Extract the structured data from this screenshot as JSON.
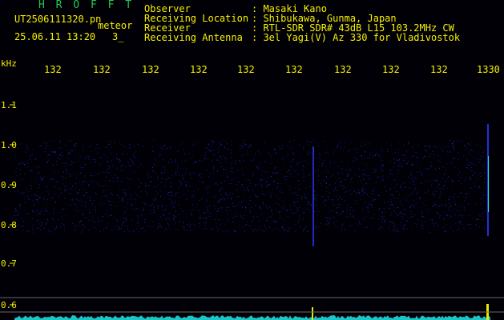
{
  "header": {
    "station": "H R O F F T",
    "filename": "UT2506111320.pn",
    "tag": "meteor",
    "datetime": "25.06.11 13:20",
    "count": "3_"
  },
  "info": [
    {
      "label": "Observer",
      "value": ": Masaki Kano"
    },
    {
      "label": "Receiving Location",
      "value": ": Shibukawa, Gunma, Japan"
    },
    {
      "label": "Receiver",
      "value": ": RTL-SDR SDR# 43dB L15 103.2MHz CW"
    },
    {
      "label": "Receiving Antenna",
      "value": ": 3el Yagi(V) Az 330 for Vladivostok"
    }
  ],
  "spectrogram": {
    "y_unit": "kHz",
    "y_ticks": [
      "1.1",
      "1.0",
      "0.9",
      "0.8",
      "0.7",
      "0.6"
    ],
    "time_ticks": [
      "132",
      "132",
      "132",
      "132",
      "132",
      "132",
      "132",
      "132",
      "132",
      "1330"
    ],
    "colors": {
      "background": "#000006",
      "text": "#f5f000",
      "noise": "#2230d8",
      "trace": "#20e8e8"
    }
  }
}
